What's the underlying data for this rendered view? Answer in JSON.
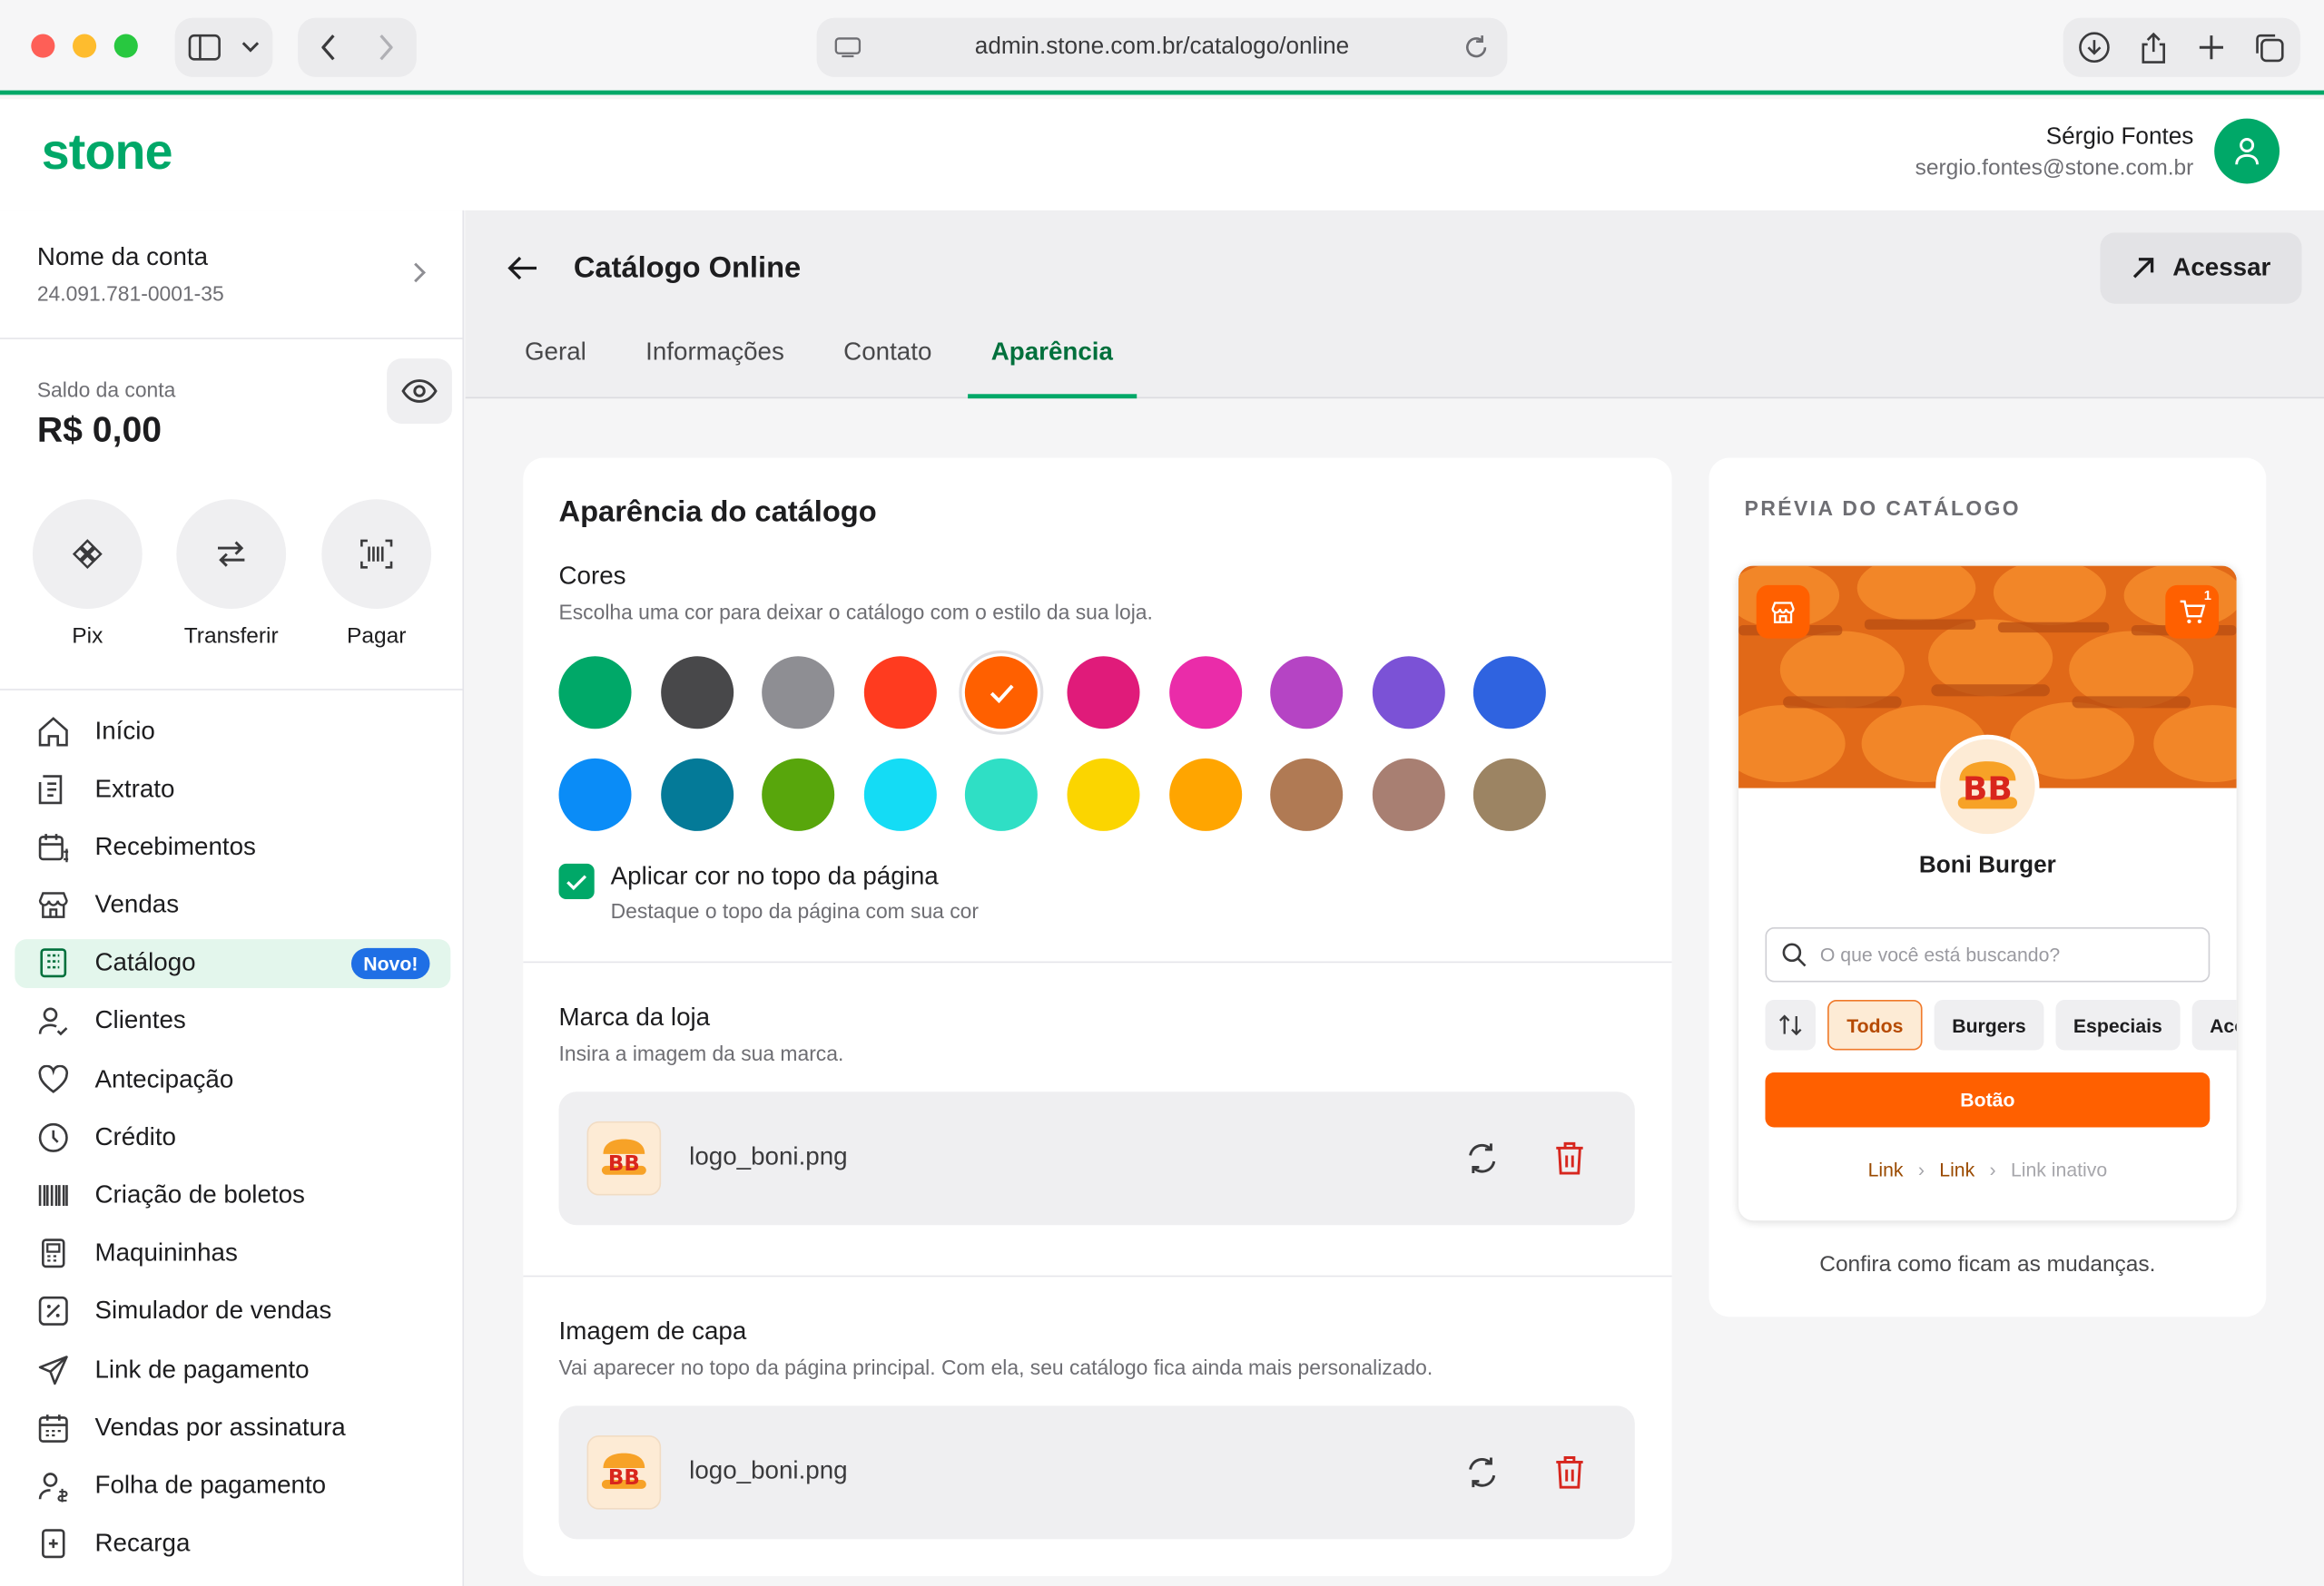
{
  "browser": {
    "url": "admin.stone.com.br/catalogo/online"
  },
  "header": {
    "logo": "stone",
    "user_name": "Sérgio Fontes",
    "user_email": "sergio.fontes@stone.com.br"
  },
  "account": {
    "name": "Nome da conta",
    "cnpj": "24.091.781-0001-35",
    "balance_label": "Saldo da conta",
    "balance_value": "R$ 0,00"
  },
  "quick_actions": [
    {
      "label": "Pix",
      "icon": "pix-icon"
    },
    {
      "label": "Transferir",
      "icon": "transfer-icon"
    },
    {
      "label": "Pagar",
      "icon": "barcode-scan-icon"
    }
  ],
  "nav": [
    {
      "label": "Início",
      "icon": "home-icon"
    },
    {
      "label": "Extrato",
      "icon": "statement-icon"
    },
    {
      "label": "Recebimentos",
      "icon": "calendar-money-icon"
    },
    {
      "label": "Vendas",
      "icon": "store-icon"
    },
    {
      "label": "Catálogo",
      "icon": "catalog-icon",
      "active": true,
      "badge": "Novo!"
    },
    {
      "label": "Clientes",
      "icon": "customers-icon"
    },
    {
      "label": "Antecipação",
      "icon": "heart-icon"
    },
    {
      "label": "Crédito",
      "icon": "clock-icon"
    },
    {
      "label": "Criação de boletos",
      "icon": "barcode-icon"
    },
    {
      "label": "Maquininhas",
      "icon": "card-machine-icon"
    },
    {
      "label": "Simulador de vendas",
      "icon": "percent-icon"
    },
    {
      "label": "Link de pagamento",
      "icon": "send-icon"
    },
    {
      "label": "Vendas por assinatura",
      "icon": "calendar-icon"
    },
    {
      "label": "Folha de pagamento",
      "icon": "payroll-icon"
    },
    {
      "label": "Recarga",
      "icon": "recharge-icon"
    }
  ],
  "page": {
    "title": "Catálogo Online",
    "access_label": "Acessar",
    "tabs": [
      "Geral",
      "Informações",
      "Contato",
      "Aparência"
    ],
    "active_tab": "Aparência"
  },
  "appearance": {
    "title": "Aparência do catálogo",
    "colors_title": "Cores",
    "colors_sub": "Escolha uma cor para deixar o catálogo com o estilo da sua loja.",
    "colors": [
      "#00a868",
      "#48484a",
      "#8e8e93",
      "#ff3b1f",
      "#ff6000",
      "#e01b7a",
      "#ea2ca9",
      "#b544c4",
      "#7b52d6",
      "#2f63e0",
      "#0a8cf7",
      "#047a98",
      "#58a60c",
      "#14dcf5",
      "#2fdfc5",
      "#fbd500",
      "#ffa500",
      "#b07a54",
      "#a87f72",
      "#9c8463"
    ],
    "selected_color": "#ff6000",
    "apply_top_label": "Aplicar cor no topo da página",
    "apply_top_sub": "Destaque o topo da página com sua cor",
    "apply_top_checked": true,
    "brand_title": "Marca da loja",
    "brand_sub": "Insira a imagem da sua marca.",
    "brand_file": "logo_boni.png",
    "cover_title": "Imagem de capa",
    "cover_sub": "Vai aparecer no topo da página principal. Com ela, seu catálogo fica ainda mais personalizado.",
    "cover_file": "logo_boni.png"
  },
  "preview": {
    "label": "PRÉVIA DO CATÁLOGO",
    "store_name": "Boni Burger",
    "logo_text": "BB",
    "cart_count": "1",
    "search_placeholder": "O que você está buscando?",
    "chips": [
      "Todos",
      "Burgers",
      "Especiais",
      "Acom"
    ],
    "active_chip": "Todos",
    "button_label": "Botão",
    "links": [
      "Link",
      "Link",
      "Link inativo"
    ],
    "caption": "Confira como ficam as mudanças."
  }
}
